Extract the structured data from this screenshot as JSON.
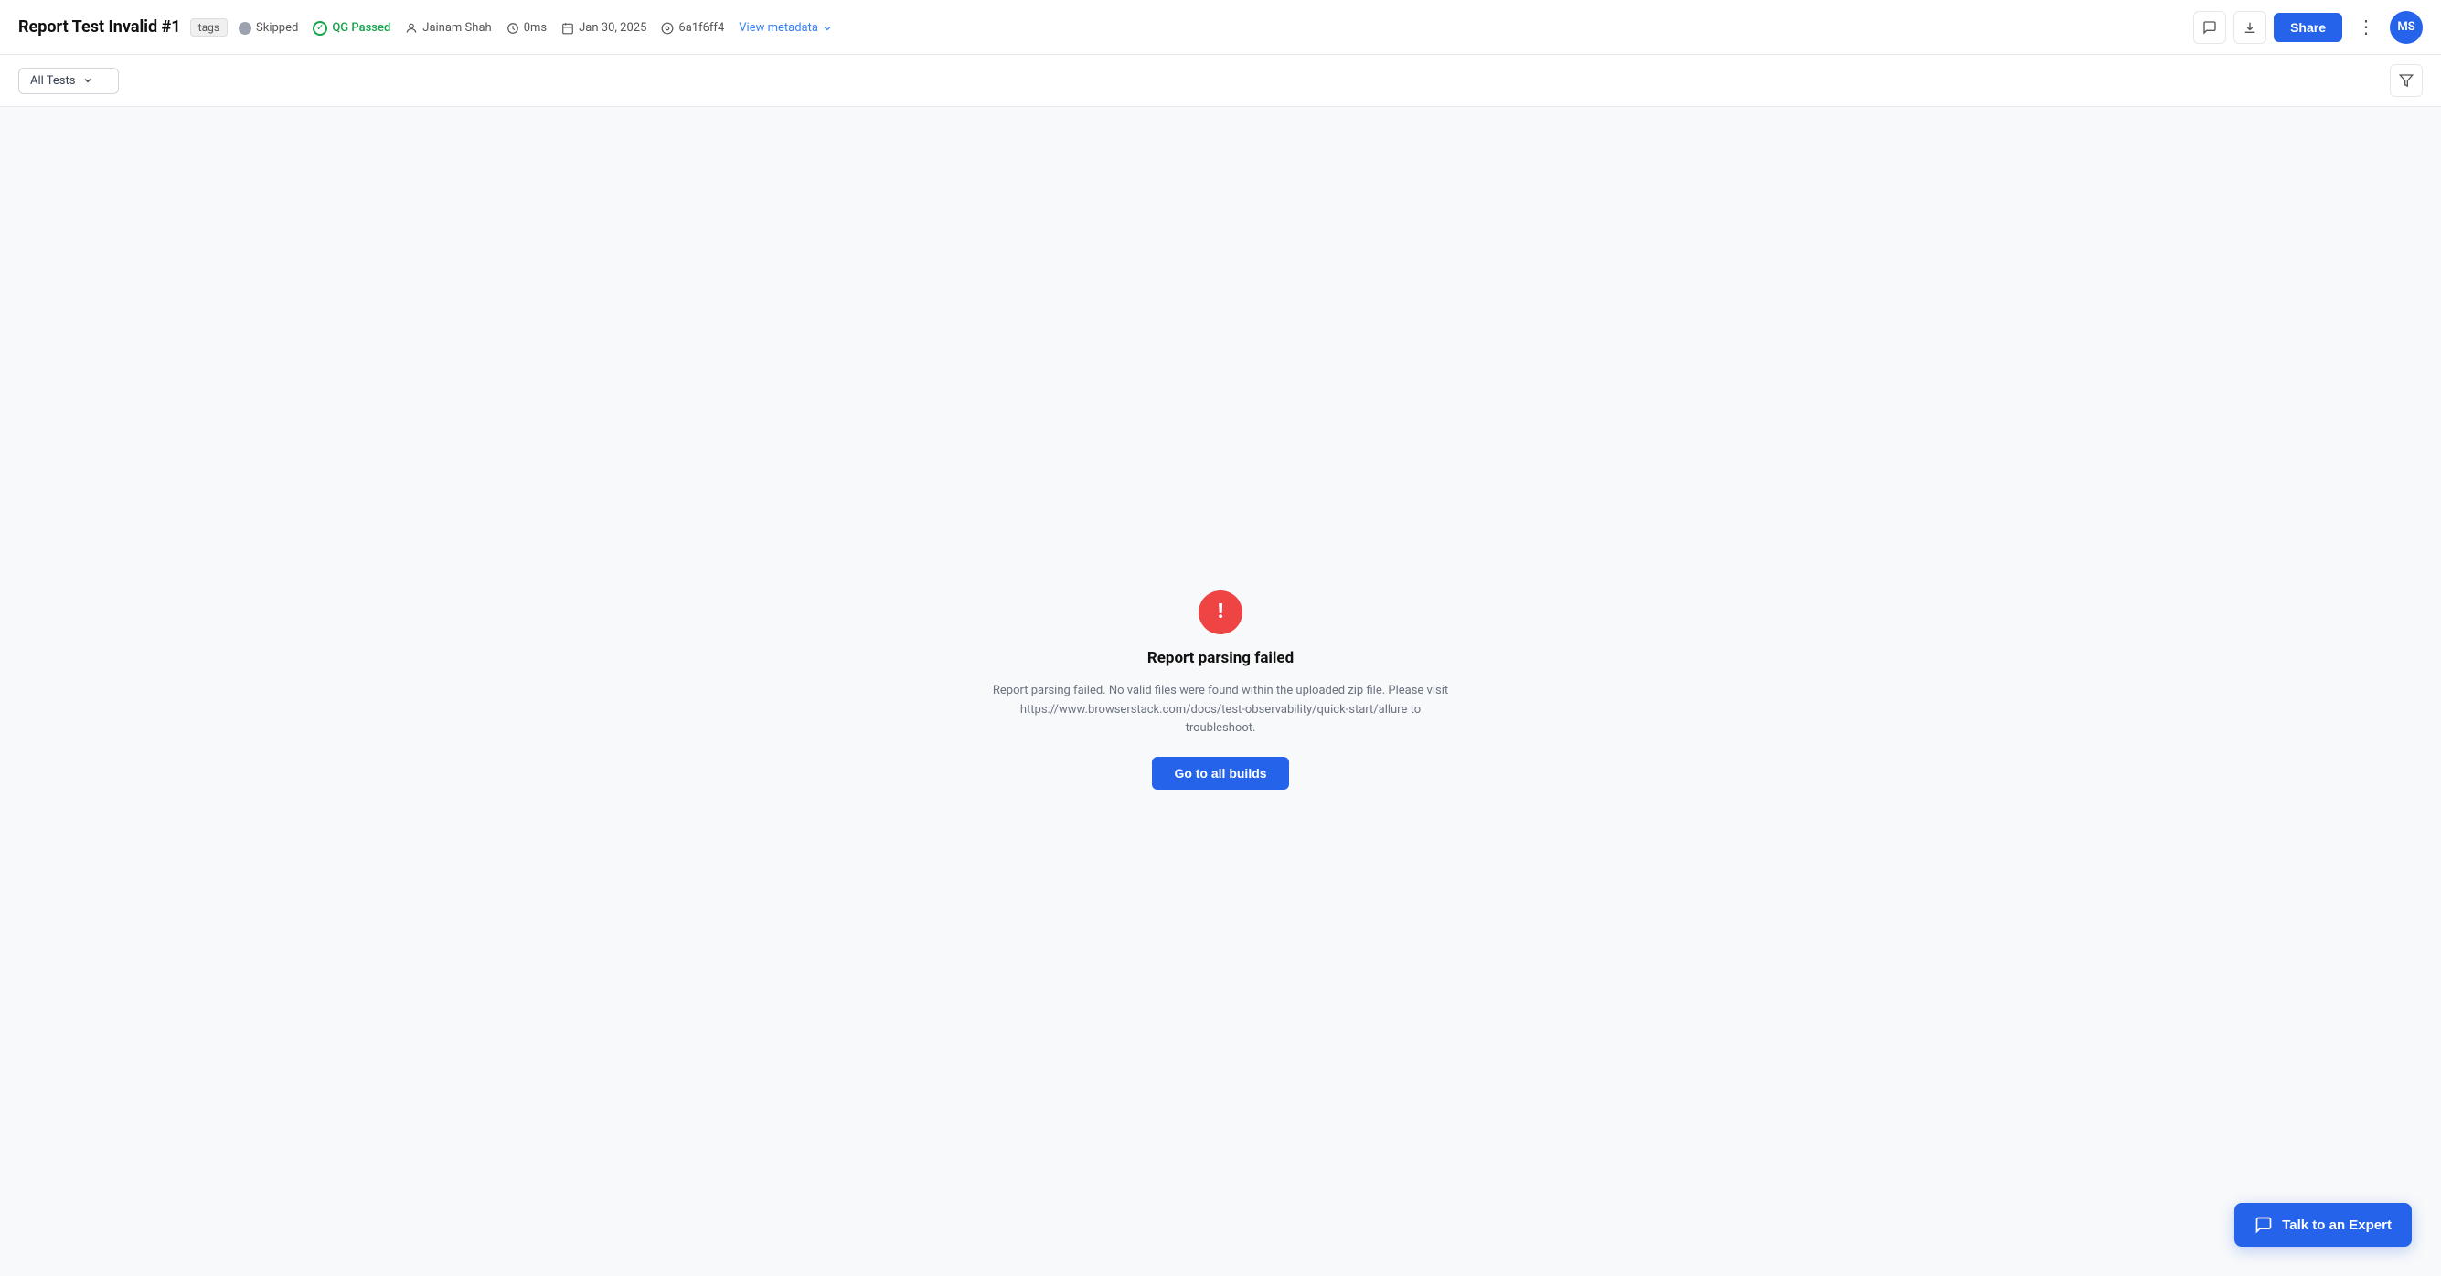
{
  "header": {
    "title": "Report Test Invalid #1",
    "tags_label": "tags",
    "status_skipped": "Skipped",
    "status_qg": "QG Passed",
    "author": "Jainam Shah",
    "duration": "0ms",
    "date": "Jan 30, 2025",
    "commit": "6a1f6ff4",
    "view_metadata": "View metadata",
    "share_label": "Share",
    "avatar_initials": "MS"
  },
  "toolbar": {
    "filter_label": "All Tests",
    "filter_placeholder": "All Tests"
  },
  "error_state": {
    "title": "Report parsing failed",
    "description": "Report parsing failed. No valid files were found within the uploaded zip file. Please visit https://www.browserstack.com/docs/test-observability/quick-start/allure to troubleshoot.",
    "cta_label": "Go to all builds"
  },
  "chat": {
    "label": "Talk to an Expert"
  },
  "icons": {
    "comment": "💬",
    "download": "⬇",
    "more": "⋮",
    "filter": "⊟",
    "chevron_down": "⌄",
    "clock": "🕐",
    "calendar": "📅",
    "github": "⊙",
    "person": "👤",
    "exclamation": "!"
  }
}
